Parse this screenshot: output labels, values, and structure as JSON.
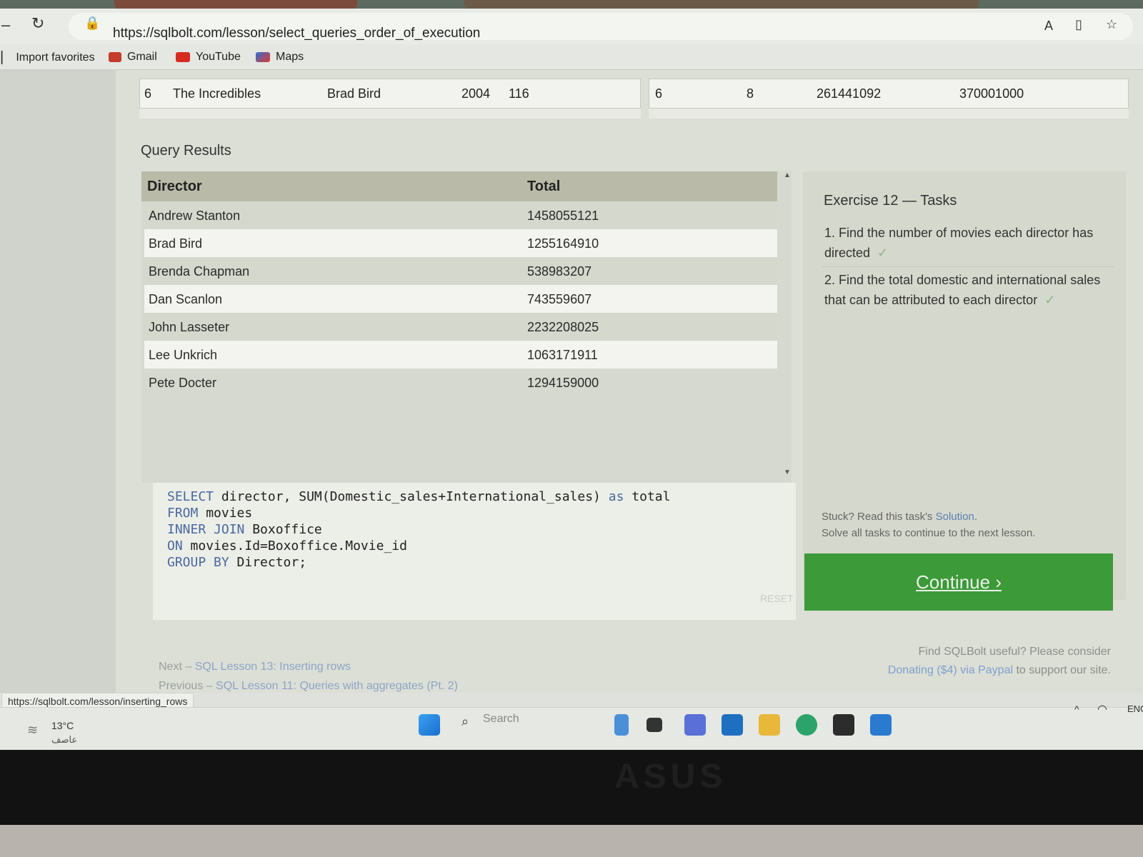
{
  "browser": {
    "url": "https://sqlbolt.com/lesson/select_queries_order_of_execution",
    "favorites": [
      {
        "label": "Import favorites",
        "icon": "import-icon"
      },
      {
        "label": "Gmail",
        "icon": "gmail-icon"
      },
      {
        "label": "YouTube",
        "icon": "youtube-icon"
      },
      {
        "label": "Maps",
        "icon": "maps-icon"
      }
    ]
  },
  "top_tables": {
    "movies_row": {
      "id": "6",
      "title": "The Incredibles",
      "director": "Brad Bird",
      "year": "2004",
      "length": "116"
    },
    "boxoffice_row": {
      "movie_id": "6",
      "rating": "8",
      "domestic": "261441092",
      "international": "370001000"
    }
  },
  "results": {
    "title": "Query Results",
    "columns": [
      "Director",
      "Total"
    ],
    "rows": [
      {
        "director": "Andrew Stanton",
        "total": "1458055121"
      },
      {
        "director": "Brad Bird",
        "total": "1255164910"
      },
      {
        "director": "Brenda Chapman",
        "total": "538983207"
      },
      {
        "director": "Dan Scanlon",
        "total": "743559607"
      },
      {
        "director": "John Lasseter",
        "total": "2232208025"
      },
      {
        "director": "Lee Unkrich",
        "total": "1063171911"
      },
      {
        "director": "Pete Docter",
        "total": "1294159000"
      }
    ]
  },
  "sql": {
    "lines": [
      {
        "kw": "SELECT",
        "rest": " director, SUM(Domestic_sales+International_sales)",
        "kw2": " as",
        "rest2": " total"
      },
      {
        "kw": "FROM",
        "rest": " movies",
        "kw2": "",
        "rest2": ""
      },
      {
        "kw": "INNER JOIN",
        "rest": " Boxoffice",
        "kw2": "",
        "rest2": ""
      },
      {
        "kw": "ON",
        "rest": " movies.Id=Boxoffice.Movie_id",
        "kw2": "",
        "rest2": ""
      },
      {
        "kw": "GROUP BY",
        "rest": " Director;",
        "kw2": "",
        "rest2": ""
      }
    ],
    "reset_label": "RESET"
  },
  "exercise": {
    "title": "Exercise 12 — Tasks",
    "tasks": [
      {
        "num": "1.",
        "text": "Find the number of movies each director has directed",
        "check": "✓"
      },
      {
        "num": "2.",
        "text": "Find the total domestic and international sales that can be attributed to each director",
        "check": "✓"
      }
    ],
    "stuck_prefix": "Stuck? Read this task's ",
    "stuck_link": "Solution",
    "stuck_suffix": ".",
    "solve_all": "Solve all tasks to continue to the next lesson.",
    "continue_label": "Continue ›"
  },
  "navigation": {
    "next_prefix": "Next – ",
    "next_link": "SQL Lesson 13: Inserting rows",
    "prev_prefix": "Previous – ",
    "prev_link": "SQL Lesson 11: Queries with aggregates (Pt. 2)"
  },
  "support": {
    "line1": "Find SQLBolt useful? Please consider",
    "link": "Donating ($4) via Paypal",
    "line2_suffix": " to support our site."
  },
  "status_url": "https://sqlbolt.com/lesson/inserting_rows",
  "taskbar": {
    "temperature": "13°C",
    "weather_text": "عاصف",
    "search_placeholder": "Search",
    "lang": "ENG"
  },
  "colors": {
    "continue_button": "#3c9a39",
    "link": "#5b7fb5"
  }
}
